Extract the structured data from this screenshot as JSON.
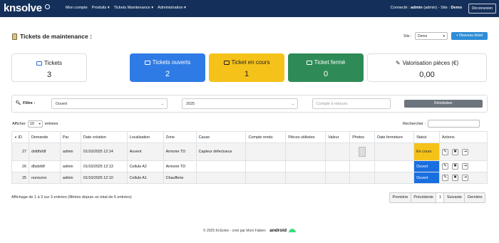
{
  "navbar": {
    "brand": "knsolve",
    "menu": [
      "Mon compte",
      "Produits ▾",
      "Tickets Maintenance ▾",
      "Administration ▾"
    ],
    "connected_prefix": "Connecté : ",
    "user": "admin",
    "role_site": " (admin) - Site : ",
    "site": "Demo",
    "logout": "Déconnexion"
  },
  "header": {
    "title": "Tickets de maintenance :",
    "site_label": "Site :",
    "site_value": "Demo",
    "new_ticket": "+ Nouveau ticket"
  },
  "cards": [
    {
      "label": "Tickets",
      "value": "3"
    },
    {
      "label": "Tickets ouverts",
      "value": "2"
    },
    {
      "label": "Ticket en cours",
      "value": "1"
    },
    {
      "label": "Ticket fermé",
      "value": "0"
    },
    {
      "label": "Valorisation pièces (€)",
      "value": "0,00"
    }
  ],
  "filter": {
    "label": "Filtre :",
    "status": "Ouvert",
    "year": "2025",
    "countdown_placeholder": "Compte à rebours",
    "reset": "Réinitialiser"
  },
  "table_controls": {
    "show": "Afficher",
    "length": "10",
    "entries": "entrées",
    "search_label": "Rechercher :"
  },
  "table": {
    "columns": [
      "ID",
      "Demande",
      "Par",
      "Date création",
      "Localisation",
      "Zone",
      "Cause",
      "Compte rendu",
      "Pièces utilisées",
      "Valeur",
      "Photos",
      "Date fermeture",
      "Statut",
      "Actions"
    ],
    "rows": [
      {
        "id": "27",
        "demande": "dsfdfsfdf",
        "par": "admin",
        "date": "01/10/2025 12:14",
        "loc": "Auvent",
        "zone": "Armoire TD",
        "cause": "Capteur défectueux",
        "cr": "",
        "pieces": "",
        "valeur": "",
        "fermeture": "",
        "statut": "En cours"
      },
      {
        "id": "26",
        "demande": "dfsdsfdf",
        "par": "admin",
        "date": "01/10/2025 12:13",
        "loc": "Cellule A2",
        "zone": "Armoire TD",
        "cause": "",
        "cr": "",
        "pieces": "",
        "valeur": "",
        "fermeture": "",
        "statut": "Ouvert"
      },
      {
        "id": "25",
        "demande": "rezrezrer",
        "par": "admin",
        "date": "01/10/2025 12:10",
        "loc": "Cellule A1",
        "zone": "Chaufferie",
        "cause": "",
        "cr": "",
        "pieces": "",
        "valeur": "",
        "fermeture": "",
        "statut": "Ouvert"
      }
    ]
  },
  "footer": {
    "info": "Affichage de 1 à 3 sur 3 entrées (filtrées depuis un total de 6 entrées)",
    "pager": [
      "Première",
      "Précédente",
      "1",
      "Suivante",
      "Dernière"
    ],
    "copyright": "© 2025 KnSolve - créé par Moni Fabien",
    "android": "android"
  },
  "colors": {
    "navbar": "#14305a",
    "blue": "#2f7be5",
    "yellow": "#f5c219",
    "green": "#2e8b57",
    "status_ouvert": "#1a6fe0"
  }
}
